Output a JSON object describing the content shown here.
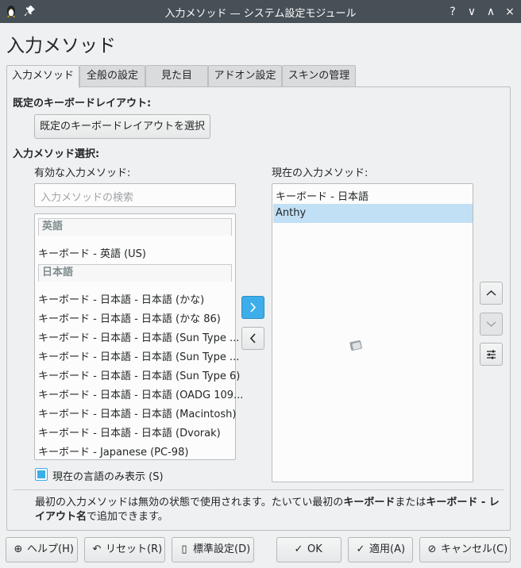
{
  "window": {
    "title": "入力メソッド — システム設定モジュール",
    "buttons": [
      "?",
      "∨",
      "∧",
      "×"
    ]
  },
  "page_title": "入力メソッド",
  "tabs": [
    {
      "label": "入力メソッド",
      "active": true
    },
    {
      "label": "全般の設定",
      "active": false
    },
    {
      "label": "見た目",
      "active": false
    },
    {
      "label": "アドオン設定",
      "active": false
    },
    {
      "label": "スキンの管理",
      "active": false
    }
  ],
  "keyboard_layout": {
    "heading": "既定のキーボードレイアウト:",
    "button_label": "既定のキーボードレイアウトを選択"
  },
  "im_select": {
    "heading": "入力メソッド選択:",
    "available_label": "有効な入力メソッド:",
    "current_label": "現在の入力メソッド:",
    "search_placeholder": "入力メソッドの検索",
    "groups": [
      {
        "name": "英語",
        "items": [
          "キーボード - 英語 (US)"
        ]
      },
      {
        "name": "日本語",
        "items": [
          "キーボード - 日本語 - 日本語 (かな)",
          "キーボード - 日本語 - 日本語 (かな 86)",
          "キーボード - 日本語 - 日本語 (Sun Type ...",
          "キーボード - 日本語 - 日本語 (Sun Type ...",
          "キーボード - 日本語 - 日本語 (Sun Type 6)",
          "キーボード - 日本語 - 日本語 (OADG 109...",
          "キーボード - 日本語 - 日本語 (Macintosh)",
          "キーボード - 日本語 - 日本語 (Dvorak)",
          "キーボード - Japanese (PC-98)"
        ]
      }
    ],
    "current_items": [
      "キーボード - 日本語",
      "Anthy"
    ],
    "selected_current_index": 1,
    "checkbox_label": "現在の言語のみ表示 (S)",
    "checkbox_checked": true
  },
  "info": {
    "text_1": "最初の入力メソッドは無効の状態で使用されます。たいてい最初の",
    "bold_1": "キーボード",
    "text_2": "または",
    "bold_2": "キーボード - レ",
    "bold_3": "イアウト名",
    "text_3": "で追加できます。"
  },
  "footer": {
    "help": "ヘルプ(H)",
    "reset": "リセット(R)",
    "defaults": "標準設定(D)",
    "ok": "OK",
    "apply": "適用(A)",
    "cancel": "キャンセル(C)"
  },
  "colors": {
    "accent": "#3daee9",
    "selection": "#c2e0f5",
    "titlebar": "#475057"
  }
}
